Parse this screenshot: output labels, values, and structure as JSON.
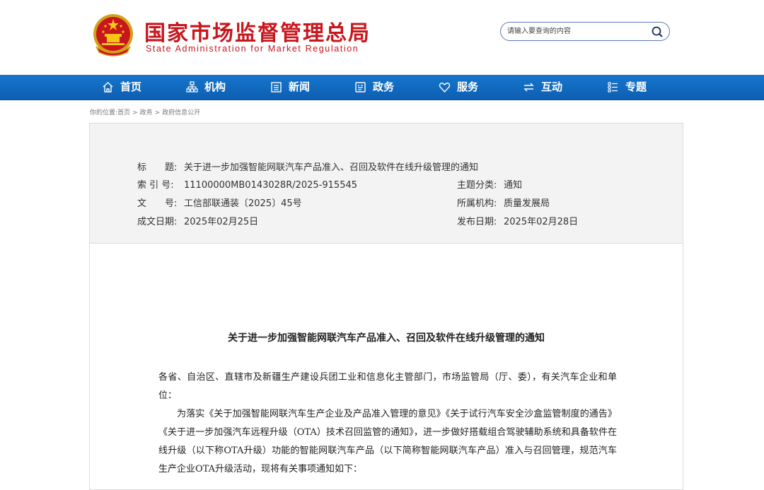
{
  "header": {
    "title": "国家市场监督管理总局",
    "subtitle": "State Administration for Market Regulation",
    "brand_color": "#c8161d"
  },
  "search": {
    "placeholder": "请输入要查询的内容",
    "icon": "search-icon"
  },
  "nav": {
    "bg_color": "#1168bf",
    "items": [
      {
        "label": "首页",
        "icon": "home-icon"
      },
      {
        "label": "机构",
        "icon": "org-chart-icon"
      },
      {
        "label": "新闻",
        "icon": "news-icon"
      },
      {
        "label": "政务",
        "icon": "affairs-icon"
      },
      {
        "label": "服务",
        "icon": "heart-icon"
      },
      {
        "label": "互动",
        "icon": "exchange-icon"
      },
      {
        "label": "专题",
        "icon": "topic-list-icon"
      }
    ]
  },
  "breadcrumb": {
    "prefix": "你的位置:",
    "items": [
      "首页",
      "政务",
      "政府信息公开"
    ],
    "separator": ">"
  },
  "meta": {
    "title_label": "标　　题:",
    "title_value": "关于进一步加强智能网联汽车产品准入、召回及软件在线升级管理的通知",
    "index_label": "索 引 号:",
    "index_value": "11100000MB0143028R/2025-915545",
    "topic_label": "主题分类:",
    "topic_value": "通知",
    "docno_label": "文　　号:",
    "docno_value": "工信部联通装〔2025〕45号",
    "org_label": "所属机构:",
    "org_value": "质量发展局",
    "created_label": "成文日期:",
    "created_value": "2025年02月25日",
    "published_label": "发布日期:",
    "published_value": "2025年02月28日"
  },
  "article": {
    "title": "关于进一步加强智能网联汽车产品准入、召回及软件在线升级管理的通知",
    "paragraph1": "各省、自治区、直辖市及新疆生产建设兵团工业和信息化主管部门，市场监管局（厅、委），有关汽车企业和单位：",
    "paragraph2": "为落实《关于加强智能网联汽车生产企业及产品准入管理的意见》《关于试行汽车安全沙盒监管制度的通告》《关于进一步加强汽车远程升级（OTA）技术召回监管的通知》，进一步做好搭载组合驾驶辅助系统和具备软件在线升级（以下称OTA升级）功能的智能网联汽车产品（以下简称智能网联汽车产品）准入与召回管理，规范汽车生产企业OTA升级活动，现将有关事项通知如下："
  }
}
